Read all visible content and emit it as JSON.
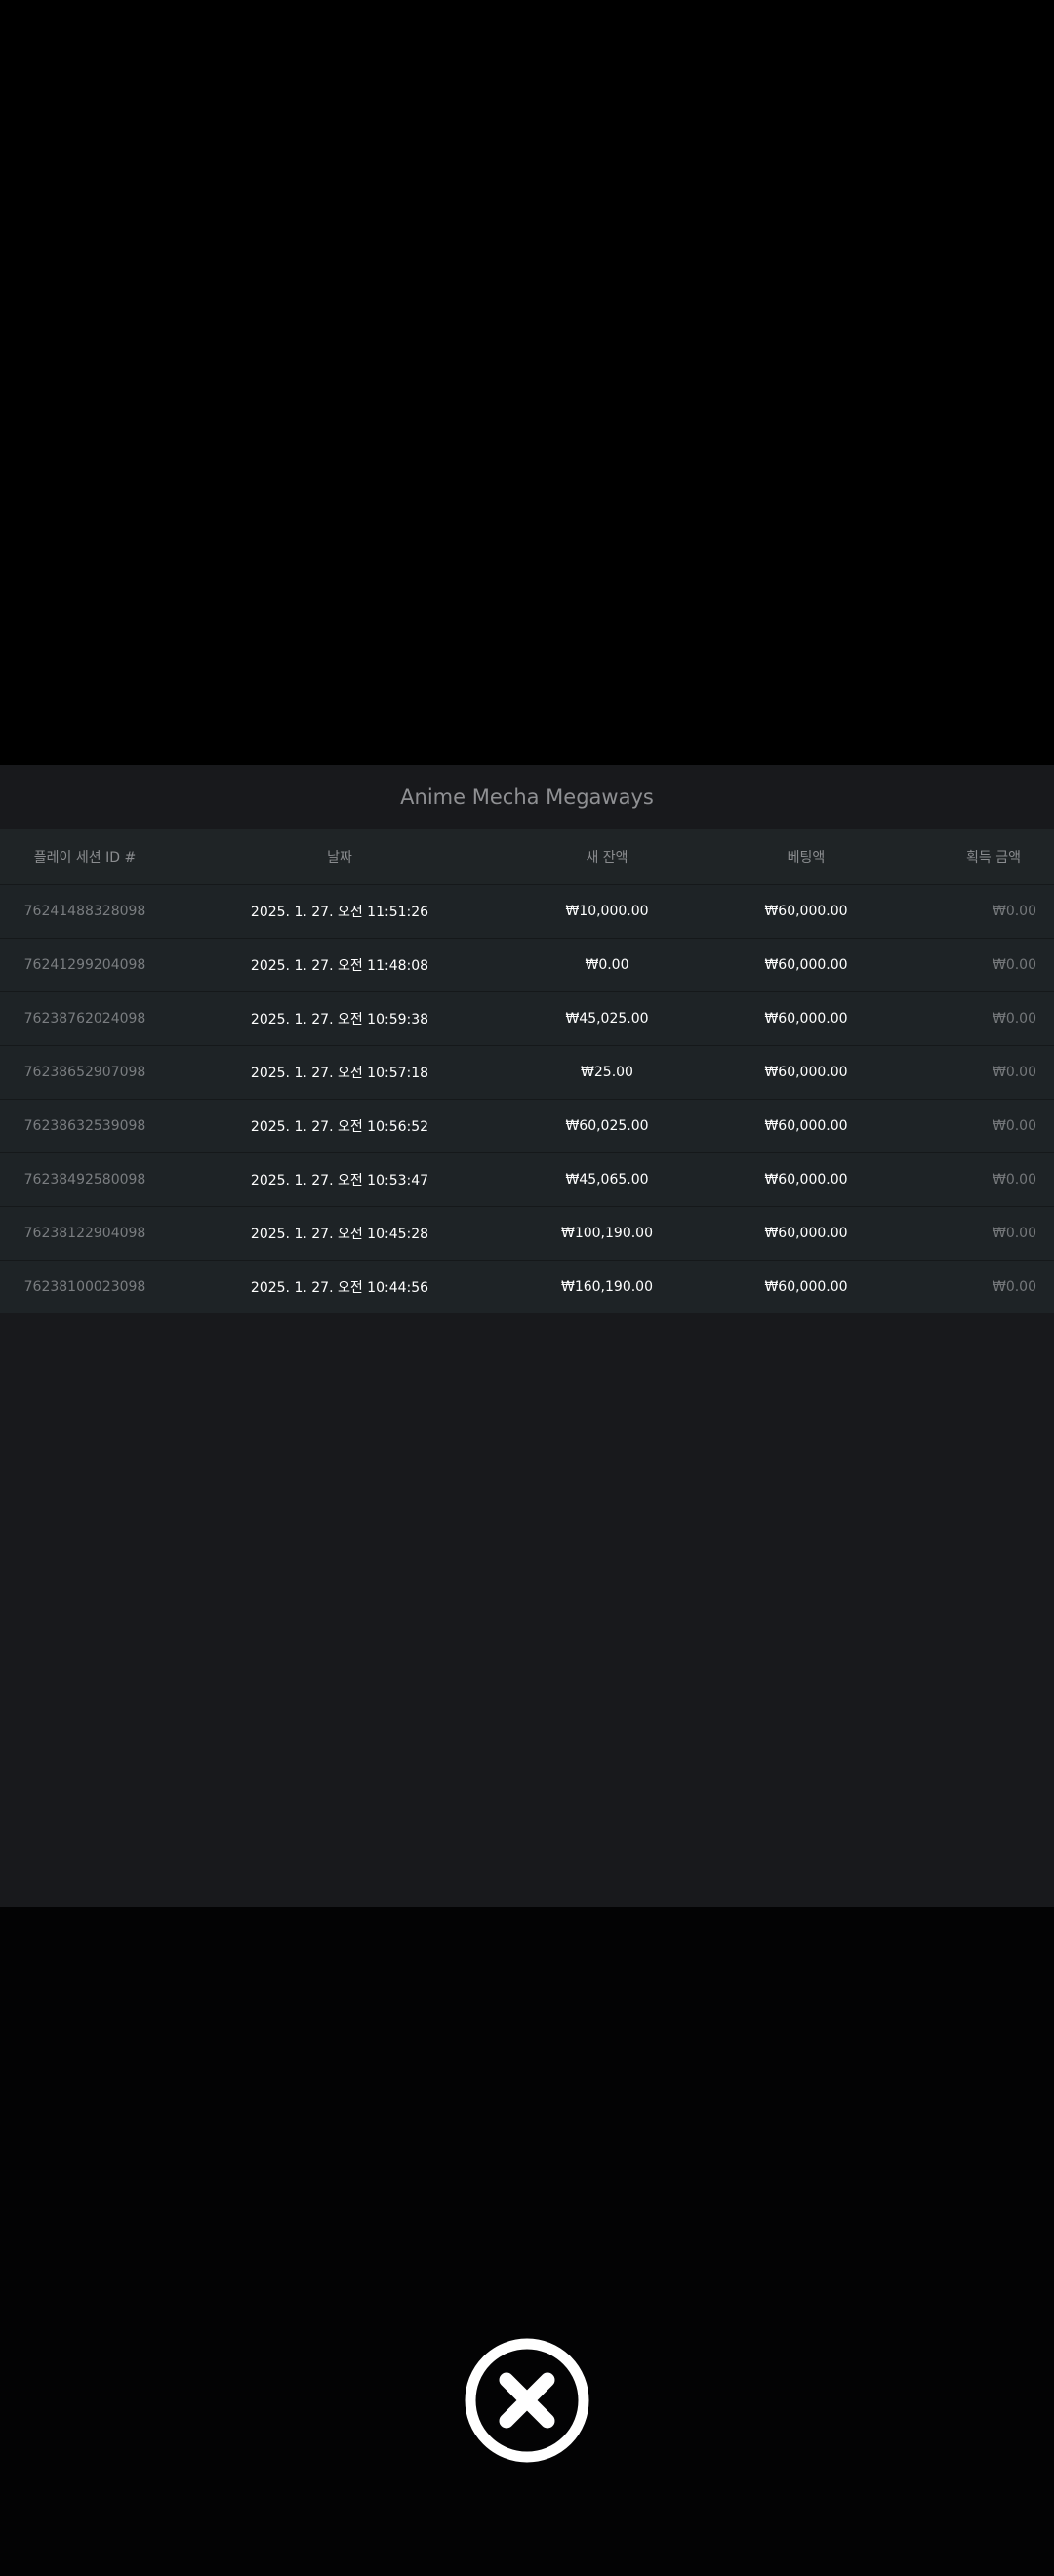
{
  "panel": {
    "title": "Anime Mecha Megaways"
  },
  "table": {
    "headers": {
      "session_id": "플레이 세션 ID #",
      "date": "날짜",
      "new_balance": "새 잔액",
      "bet": "베팅액",
      "win": "획득 금액"
    },
    "rows": [
      {
        "session_id": "762414883280​98",
        "date": "2025. 1. 27. 오전 11:51:26",
        "new_balance": "₩10,000.00",
        "bet": "₩60,000.00",
        "win": "₩0.00"
      },
      {
        "session_id": "762412992040​98",
        "date": "2025. 1. 27. 오전 11:48:08",
        "new_balance": "₩0.00",
        "bet": "₩60,000.00",
        "win": "₩0.00"
      },
      {
        "session_id": "762387620240​98",
        "date": "2025. 1. 27. 오전 10:59:38",
        "new_balance": "₩45,025.00",
        "bet": "₩60,000.00",
        "win": "₩0.00"
      },
      {
        "session_id": "762386529070​98",
        "date": "2025. 1. 27. 오전 10:57:18",
        "new_balance": "₩25.00",
        "bet": "₩60,000.00",
        "win": "₩0.00"
      },
      {
        "session_id": "762386325390​98",
        "date": "2025. 1. 27. 오전 10:56:52",
        "new_balance": "₩60,025.00",
        "bet": "₩60,000.00",
        "win": "₩0.00"
      },
      {
        "session_id": "762384925800​98",
        "date": "2025. 1. 27. 오전 10:53:47",
        "new_balance": "₩45,065.00",
        "bet": "₩60,000.00",
        "win": "₩0.00"
      },
      {
        "session_id": "762381229040​98",
        "date": "2025. 1. 27. 오전 10:45:28",
        "new_balance": "₩100,190.00",
        "bet": "₩60,000.00",
        "win": "₩0.00"
      },
      {
        "session_id": "762381000230​98",
        "date": "2025. 1. 27. 오전 10:44:56",
        "new_balance": "₩160,190.00",
        "bet": "₩60,000.00",
        "win": "₩0.00"
      }
    ]
  },
  "close_button": {
    "icon": "close-x-circle-icon"
  },
  "colors": {
    "panel_bg": "#18191c",
    "row_bg": "#1e2326",
    "muted_text": "#7a7d80",
    "primary_text": "#ffffff"
  }
}
